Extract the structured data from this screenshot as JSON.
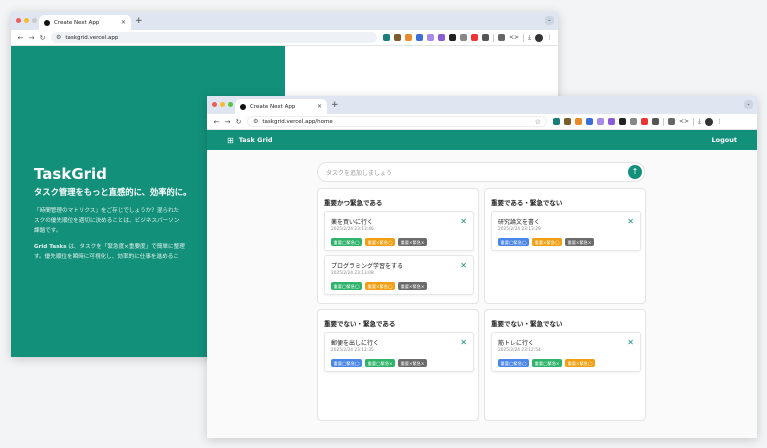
{
  "colors": {
    "brand": "#12907a",
    "tag_blue": "#4a86e8",
    "tag_green": "#2fb36a",
    "tag_orange": "#f0a012",
    "tag_gray": "#6b6b6b"
  },
  "back_window": {
    "tab_title": "Create Next App",
    "url": "taskgrid.vercel.app",
    "hero": {
      "title": "TaskGrid",
      "subtitle": "タスク管理をもっと直感的に、効率的に。",
      "p1_line1": "「時間管理のマトリクス」をご存じでしょうか？混られた",
      "p1_line2": "スクの優先順位を適切に決めることは、ビジネスパーソン",
      "p1_line3": "課題です。",
      "p2_strong": "Grid Tasks",
      "p2_line1_rest": " は、タスクを「緊急度×重要度」で簡単に整理",
      "p2_line2": "す。優先順位を瞬時に可視化し、効率的に仕事を進めるこ"
    }
  },
  "front_window": {
    "tab_title": "Create Next App",
    "url": "taskgrid.vercel.app/home",
    "header": {
      "brand": "Task Grid",
      "logout": "Logout"
    },
    "input": {
      "placeholder": "タスクを追加しましょう"
    },
    "quadrants": [
      {
        "title": "重要かつ緊急である",
        "tasks": [
          {
            "title": "薬を買いに行く",
            "date": "2025/2/24 23:13:46",
            "tags": [
              "重要◯緊急◯",
              "重要×緊急◯",
              "重要×緊急×"
            ]
          },
          {
            "title": "プログラミング学習をする",
            "date": "2025/2/24 23:13:08",
            "tags": [
              "重要◯緊急◯",
              "重要×緊急◯",
              "重要×緊急×"
            ]
          }
        ]
      },
      {
        "title": "重要である・緊急でない",
        "tasks": [
          {
            "title": "研究論文を書く",
            "date": "2025/2/24 23:13:29",
            "tags": [
              "重要◯緊急◯",
              "重要×緊急◯",
              "重要×緊急×"
            ]
          }
        ]
      },
      {
        "title": "重要でない・緊急である",
        "tasks": [
          {
            "title": "郵便を出しに行く",
            "date": "2025/2/24 23:12:35",
            "tags": [
              "重要◯緊急◯",
              "重要◯緊急×",
              "重要×緊急×"
            ]
          }
        ]
      },
      {
        "title": "重要でない・緊急でない",
        "tasks": [
          {
            "title": "筋トレに行く",
            "date": "2025/2/24 23:12:54",
            "tags": [
              "重要◯緊急◯",
              "重要◯緊急×",
              "重要×緊急◯"
            ]
          }
        ]
      }
    ]
  }
}
